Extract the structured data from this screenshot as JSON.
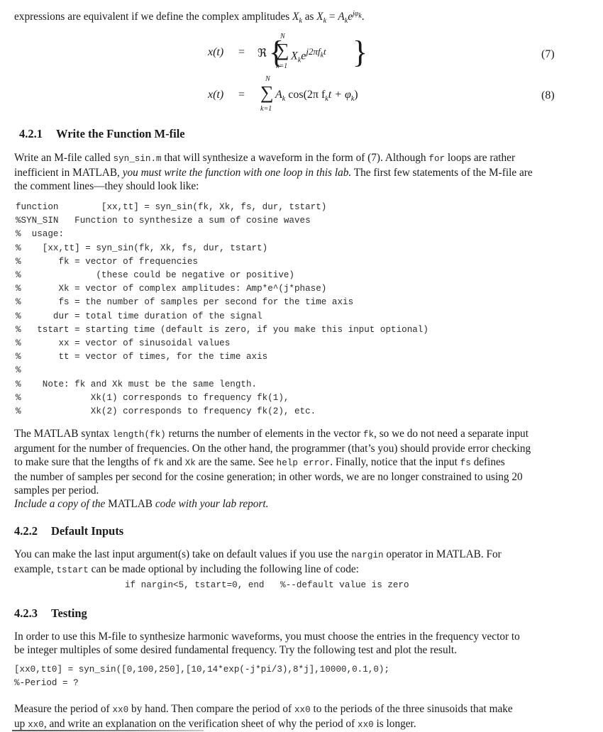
{
  "intro": {
    "text": "expressions are equivalent if we define the complex amplitudes ",
    "xk": "X",
    "sub_k": "k",
    "as": " as ",
    "eq": " = ",
    "A": "A",
    "e": "e",
    "exp": "jφ",
    "end": "."
  },
  "equations": [
    {
      "lhs": "x(t)",
      "eq": "=",
      "re": "ℜ",
      "sum_top": "N",
      "sum_bot": "k=1",
      "body_main": "X",
      "body_sub": "k",
      "body_e": "e",
      "body_sup": "j2πf",
      "body_sup_sub": "k",
      "body_sup_t": "t",
      "number": "(7)"
    },
    {
      "lhs": "x(t)",
      "eq": "=",
      "sum_top": "N",
      "sum_bot": "k=1",
      "body": "A",
      "body_sub": "k",
      "body_rest": " cos(2π f",
      "body_rest_sub": "k",
      "body_rest2": "t + φ",
      "body_rest2_sub": "k",
      "body_close": ")",
      "number": "(8)"
    }
  ],
  "section1": {
    "number": "4.2.1",
    "title": "Write the Function M-file",
    "p1_a": "Write an M-file called ",
    "p1_code1": "syn_sin.m",
    "p1_b": " that will synthesize a waveform in the form of (7). Although ",
    "p1_code2": "for",
    "p1_c": " loops are rather",
    "p2_a": "inefficient in M",
    "p2_sc": "ATLAB",
    "p2_b": ", ",
    "p2_i": "you must write the function with one loop in this lab.",
    "p2_c": " The first few statements of the M-file are",
    "p3": "the comment lines—they should look like:",
    "code_lines": [
      "function        [xx,tt] = syn_sin(fk, Xk, fs, dur, tstart)",
      "%SYN_SIN   Function to synthesize a sum of cosine waves",
      "%  usage:",
      "%    [xx,tt] = syn_sin(fk, Xk, fs, dur, tstart)",
      "%       fk = vector of frequencies",
      "%              (these could be negative or positive)",
      "%       Xk = vector of complex amplitudes: Amp*e^(j*phase)",
      "%       fs = the number of samples per second for the time axis",
      "%      dur = total time duration of the signal",
      "%   tstart = starting time (default is zero, if you make this input optional)",
      "%       xx = vector of sinusoidal values",
      "%       tt = vector of times, for the time axis",
      "%",
      "%    Note: fk and Xk must be the same length.",
      "%             Xk(1) corresponds to frequency fk(1),",
      "%             Xk(2) corresponds to frequency fk(2), etc."
    ],
    "q1_a": "The M",
    "q1_sc": "ATLAB",
    "q1_b": " syntax ",
    "q1_code": "length(fk)",
    "q1_c": " returns the number of elements in the vector ",
    "q1_code2": "fk",
    "q1_d": ", so we do not need a separate input",
    "q2": "argument for the number of frequencies. On the other hand, the programmer (that’s you) should provide error checking",
    "q3_a": "to make sure that the lengths of ",
    "q3_code1": "fk",
    "q3_b": " and ",
    "q3_code2": "Xk",
    "q3_c": " are the same.  See ",
    "q3_code3": "help error",
    "q3_d": ". Finally, notice that the input ",
    "q3_code4": "fs",
    "q3_e": " defines",
    "q4": "the number of samples per second for the cosine generation; in other words, we are no longer constrained to using 20",
    "q5": "samples per period.",
    "q6_a": "Include a copy of the ",
    "q6_sc1": "M",
    "q6_sc": "ATLAB",
    "q6_b": " code with your lab report."
  },
  "section2": {
    "number": "4.2.2",
    "title": "Default Inputs",
    "p1_a": "You can make the last input argument(s) take on default values if you use the ",
    "p1_code": "nargin",
    "p1_b": " operator in M",
    "p1_sc": "ATLAB",
    "p1_c": ".  For",
    "p2_a": "example, ",
    "p2_code": "tstart",
    "p2_b": " can be made optional by including the following line of code:",
    "code": "if nargin<5, tstart=0, end   %--default value is zero"
  },
  "section3": {
    "number": "4.2.3",
    "title": "Testing",
    "p1": "In order to use this M-file to synthesize harmonic waveforms, you must choose the entries in the frequency vector to",
    "p2": "be integer multiples of some desired fundamental frequency. Try the following test and plot the result.",
    "code_lines": [
      "[xx0,tt0] = syn_sin([0,100,250],[10,14*exp(-j*pi/3),8*j],10000,0.1,0);",
      "%-Period = ?"
    ],
    "m1_a": "Measure the period of ",
    "m1_code": "xx0",
    "m1_b": " by hand. Then compare the period of ",
    "m1_code2": "xx0",
    "m1_c": " to the periods of the three sinusoids that make",
    "m2_a": "up ",
    "m2_code": "xx0",
    "m2_b": ", and write an explanation on the verification sheet of why the period of ",
    "m2_code2": "xx0",
    "m2_c": " is longer."
  }
}
